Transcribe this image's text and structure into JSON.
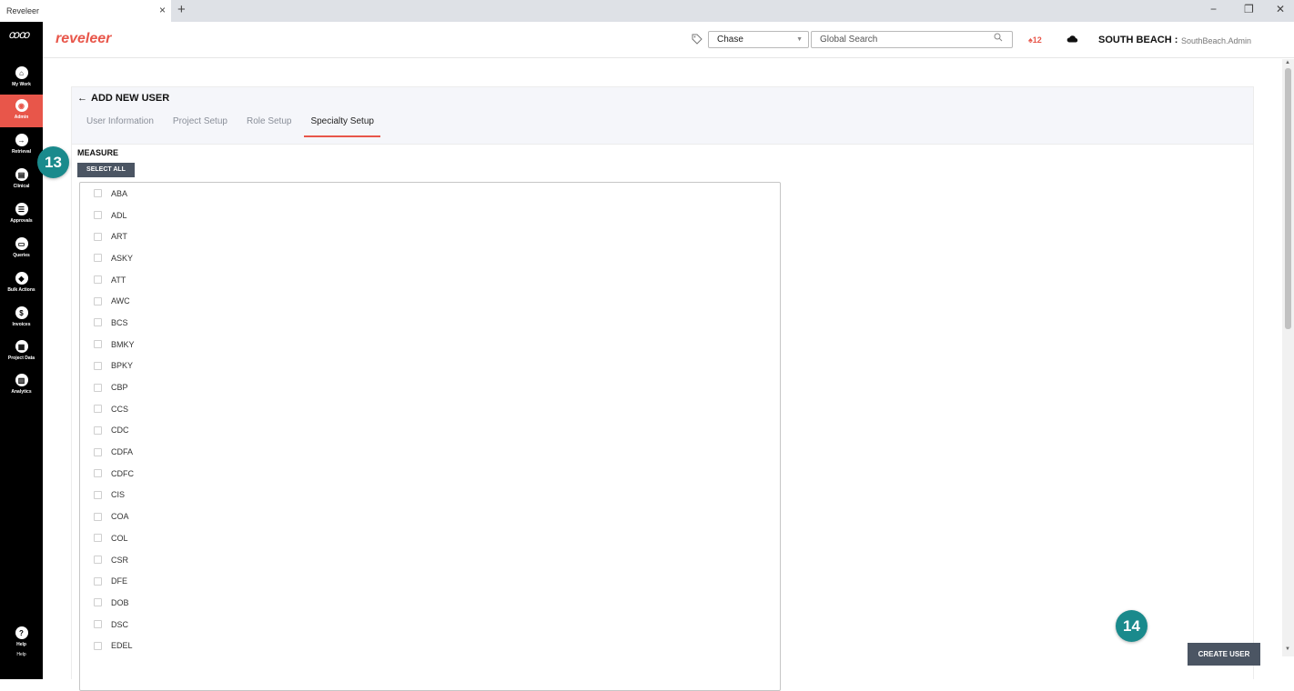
{
  "browser": {
    "tab_title": "Reveleer",
    "tab_close": "×",
    "new_tab": "+",
    "minimize": "−",
    "restore": "❐",
    "close": "✕"
  },
  "sidebar": {
    "logo": "ꝏꝏ",
    "items": [
      {
        "label": "My Work",
        "icon": "home-icon",
        "glyph": "⌂"
      },
      {
        "label": "Admin",
        "icon": "admin-icon",
        "glyph": "◉"
      },
      {
        "label": "Retrieval",
        "icon": "retrieval-icon",
        "glyph": "→"
      },
      {
        "label": "Clinical",
        "icon": "clinical-icon",
        "glyph": "▤"
      },
      {
        "label": "Approvals",
        "icon": "approvals-icon",
        "glyph": "☰"
      },
      {
        "label": "Queries",
        "icon": "queries-icon",
        "glyph": "▭"
      },
      {
        "label": "Bulk Actions",
        "icon": "bulk-actions-icon",
        "glyph": "◆"
      },
      {
        "label": "Invoices",
        "icon": "invoices-icon",
        "glyph": "$"
      },
      {
        "label": "Project Data",
        "icon": "project-data-icon",
        "glyph": "▦"
      },
      {
        "label": "Analytics",
        "icon": "analytics-icon",
        "glyph": "▥"
      }
    ],
    "help_label": "Help",
    "help_label_2": "Help",
    "help_glyph": "?"
  },
  "header": {
    "brand": "reveleer",
    "chase_select": "Chase",
    "search_placeholder": "Global Search",
    "notification_count": "12",
    "org_name": "SOUTH BEACH :",
    "user_name": "SouthBeach.Admin"
  },
  "page": {
    "title": "ADD NEW USER",
    "back_arrow": "←",
    "tabs": [
      "User Information",
      "Project Setup",
      "Role Setup",
      "Specialty Setup"
    ],
    "active_tab": "Specialty Setup"
  },
  "measure": {
    "title": "MEASURE",
    "select_all_label": "SELECT ALL",
    "items": [
      "ABA",
      "ADL",
      "ART",
      "ASKY",
      "ATT",
      "AWC",
      "BCS",
      "BMKY",
      "BPKY",
      "CBP",
      "CCS",
      "CDC",
      "CDFA",
      "CDFC",
      "CIS",
      "COA",
      "COL",
      "CSR",
      "DFE",
      "DOB",
      "DSC",
      "EDEL"
    ]
  },
  "actions": {
    "create_user_label": "CREATE USER"
  },
  "badges": {
    "step_a": "13",
    "step_b": "14"
  },
  "colors": {
    "accent": "#e8564a",
    "badge": "#1a8a8c",
    "button": "#4b5563"
  }
}
